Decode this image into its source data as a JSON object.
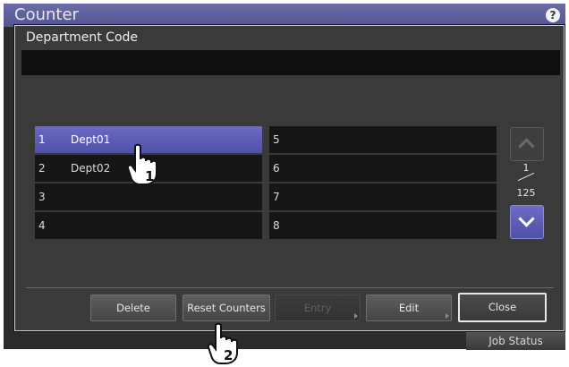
{
  "background": {
    "title": "Counter",
    "job_status": "Job Status",
    "help": "?"
  },
  "dialog": {
    "title": "Department Code",
    "list": [
      {
        "num": "1",
        "name": "Dept01",
        "selected": true
      },
      {
        "num": "2",
        "name": "Dept02",
        "selected": false
      },
      {
        "num": "3",
        "name": "",
        "selected": false
      },
      {
        "num": "4",
        "name": "",
        "selected": false
      },
      {
        "num": "5",
        "name": "",
        "selected": false
      },
      {
        "num": "6",
        "name": "",
        "selected": false
      },
      {
        "num": "7",
        "name": "",
        "selected": false
      },
      {
        "num": "8",
        "name": "",
        "selected": false
      }
    ],
    "pager": {
      "current": "1",
      "total": "125"
    },
    "buttons": {
      "delete": "Delete",
      "reset": "Reset Counters",
      "entry": "Entry",
      "edit": "Edit",
      "close": "Close"
    }
  },
  "callouts": {
    "step1": "1",
    "step2": "2"
  },
  "colors": {
    "selected": "#5d5dbb",
    "header": "#5f5f9c"
  }
}
